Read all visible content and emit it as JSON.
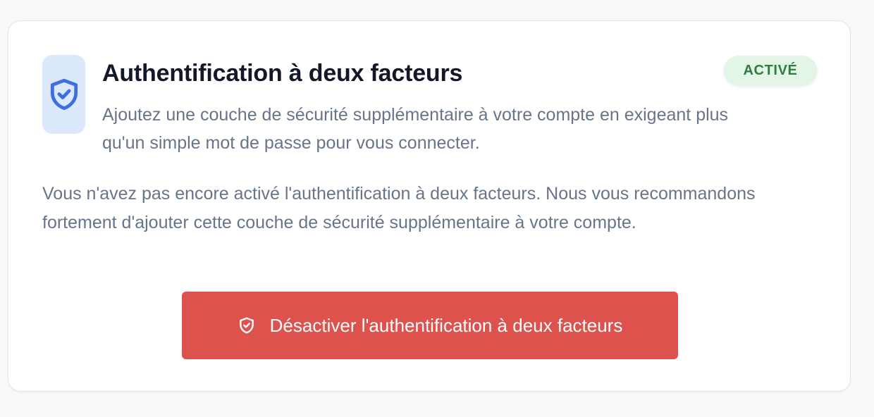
{
  "card": {
    "title": "Authentification à deux facteurs",
    "subtitle": "Ajoutez une couche de sécurité supplémentaire à votre compte en exigeant plus qu'un simple mot de passe pour vous connecter.",
    "icon": "shield-check-icon",
    "status_badge": "ACTIVÉ",
    "body_text": "Vous n'avez pas encore activé l'authentification à deux facteurs. Nous vous recommandons fortement d'ajouter cette couche de sécurité supplémentaire à votre compte.",
    "disable_button": {
      "label": "Désactiver l'authentification à deux facteurs",
      "icon": "shield-check-icon"
    }
  },
  "colors": {
    "page_background": "#f8f9fb",
    "card_background": "#ffffff",
    "icon_tile_background": "#dce8fc",
    "icon_accent": "#3d6fe0",
    "title_text": "#111827",
    "secondary_text": "#66758a",
    "badge_background": "#e3f5e6",
    "badge_text": "#2e7d43",
    "danger_button": "#dd524c",
    "danger_button_text": "#ffffff"
  }
}
